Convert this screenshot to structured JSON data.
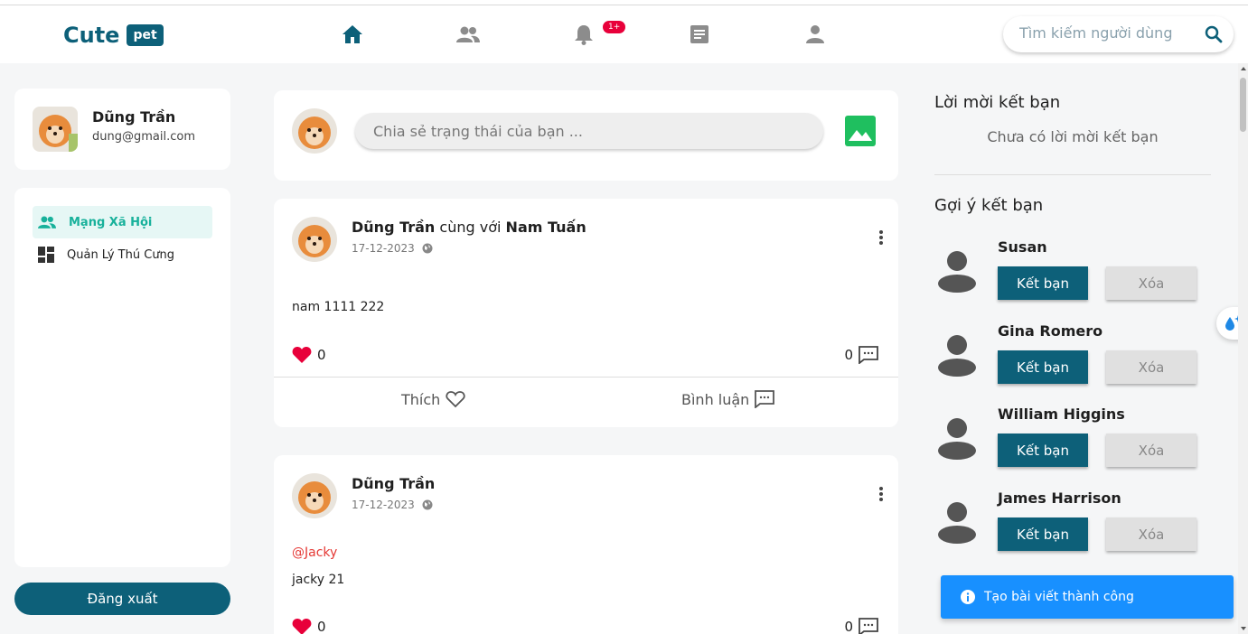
{
  "app": {
    "logo_text": "Cute",
    "logo_badge": "pet",
    "notification_badge": "1+",
    "search_placeholder": "Tìm kiếm người dùng"
  },
  "user": {
    "name": "Dũng Trần",
    "email": "dung@gmail.com"
  },
  "sidebar": {
    "items": [
      {
        "label": "Mạng Xã Hội",
        "active": true
      },
      {
        "label": "Quản Lý Thú Cưng",
        "active": false
      }
    ],
    "logout_label": "Đăng xuất"
  },
  "compose": {
    "placeholder": "Chia sẻ trạng thái của bạn ..."
  },
  "posts": [
    {
      "author": "Dũng Trần",
      "with_text": "cùng với",
      "tagged": "Nam Tuấn",
      "date": "17-12-2023",
      "content": "nam 1111 222",
      "likes": "0",
      "comments": "0",
      "like_label": "Thích",
      "comment_label": "Bình luận"
    },
    {
      "author": "Dũng Trần",
      "date": "17-12-2023",
      "mention": "@Jacky",
      "content": "jacky 21",
      "likes": "0",
      "comments": "0"
    }
  ],
  "friend_requests": {
    "title": "Lời mời kết bạn",
    "empty_text": "Chưa có lời mời kết bạn"
  },
  "suggestions": {
    "title": "Gợi ý kết bạn",
    "add_label": "Kết bạn",
    "remove_label": "Xóa",
    "people": [
      {
        "name": "Susan"
      },
      {
        "name": "Gina Romero"
      },
      {
        "name": "William Higgins"
      },
      {
        "name": "James Harrison"
      }
    ]
  },
  "toast": {
    "message": "Tạo bài viết thành công"
  },
  "colors": {
    "primary": "#0d6079",
    "accent_green": "#18b19b",
    "like_red": "#e8003a",
    "toast_blue": "#1890ff"
  }
}
